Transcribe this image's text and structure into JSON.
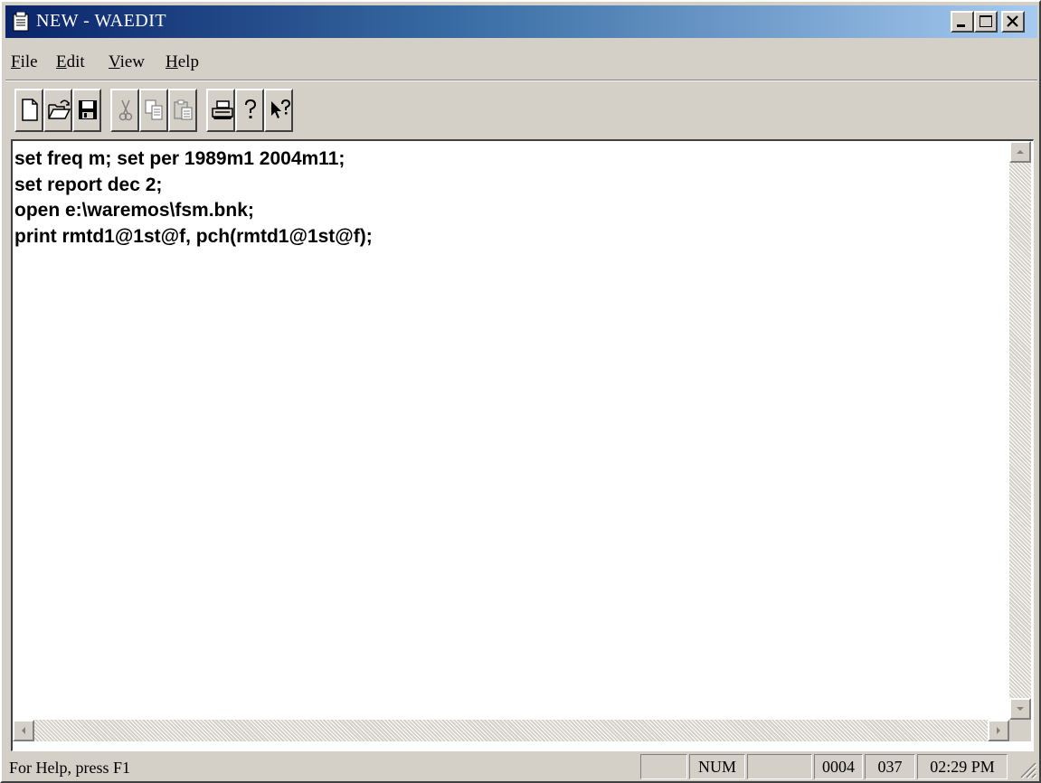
{
  "window": {
    "title": "NEW - WAEDIT"
  },
  "menu": {
    "file": "File",
    "edit": "Edit",
    "view": "View",
    "help": "Help"
  },
  "toolbar": {
    "buttons": [
      {
        "icon": "new-file-icon"
      },
      {
        "icon": "open-folder-icon"
      },
      {
        "icon": "save-disk-icon"
      },
      {
        "icon": "cut-scissors-icon",
        "enabled": false
      },
      {
        "icon": "copy-icon",
        "enabled": false
      },
      {
        "icon": "paste-icon",
        "enabled": false
      },
      {
        "icon": "print-icon"
      },
      {
        "icon": "help-question-icon"
      },
      {
        "icon": "context-help-arrow-icon"
      }
    ]
  },
  "editor": {
    "lines": [
      "set freq m; set per 1989m1 2004m11;",
      "set report dec 2;",
      "open e:\\waremos\\fsm.bnk;",
      "print rmtd1@1st@f, pch(rmtd1@1st@f);"
    ]
  },
  "statusbar": {
    "help_text": "For Help, press F1",
    "num": "NUM",
    "line": "0004",
    "col": "037",
    "time": "02:29 PM"
  },
  "colors": {
    "title_start": "#0a246a",
    "title_end": "#a6caf0",
    "face": "#d4d0c8"
  }
}
